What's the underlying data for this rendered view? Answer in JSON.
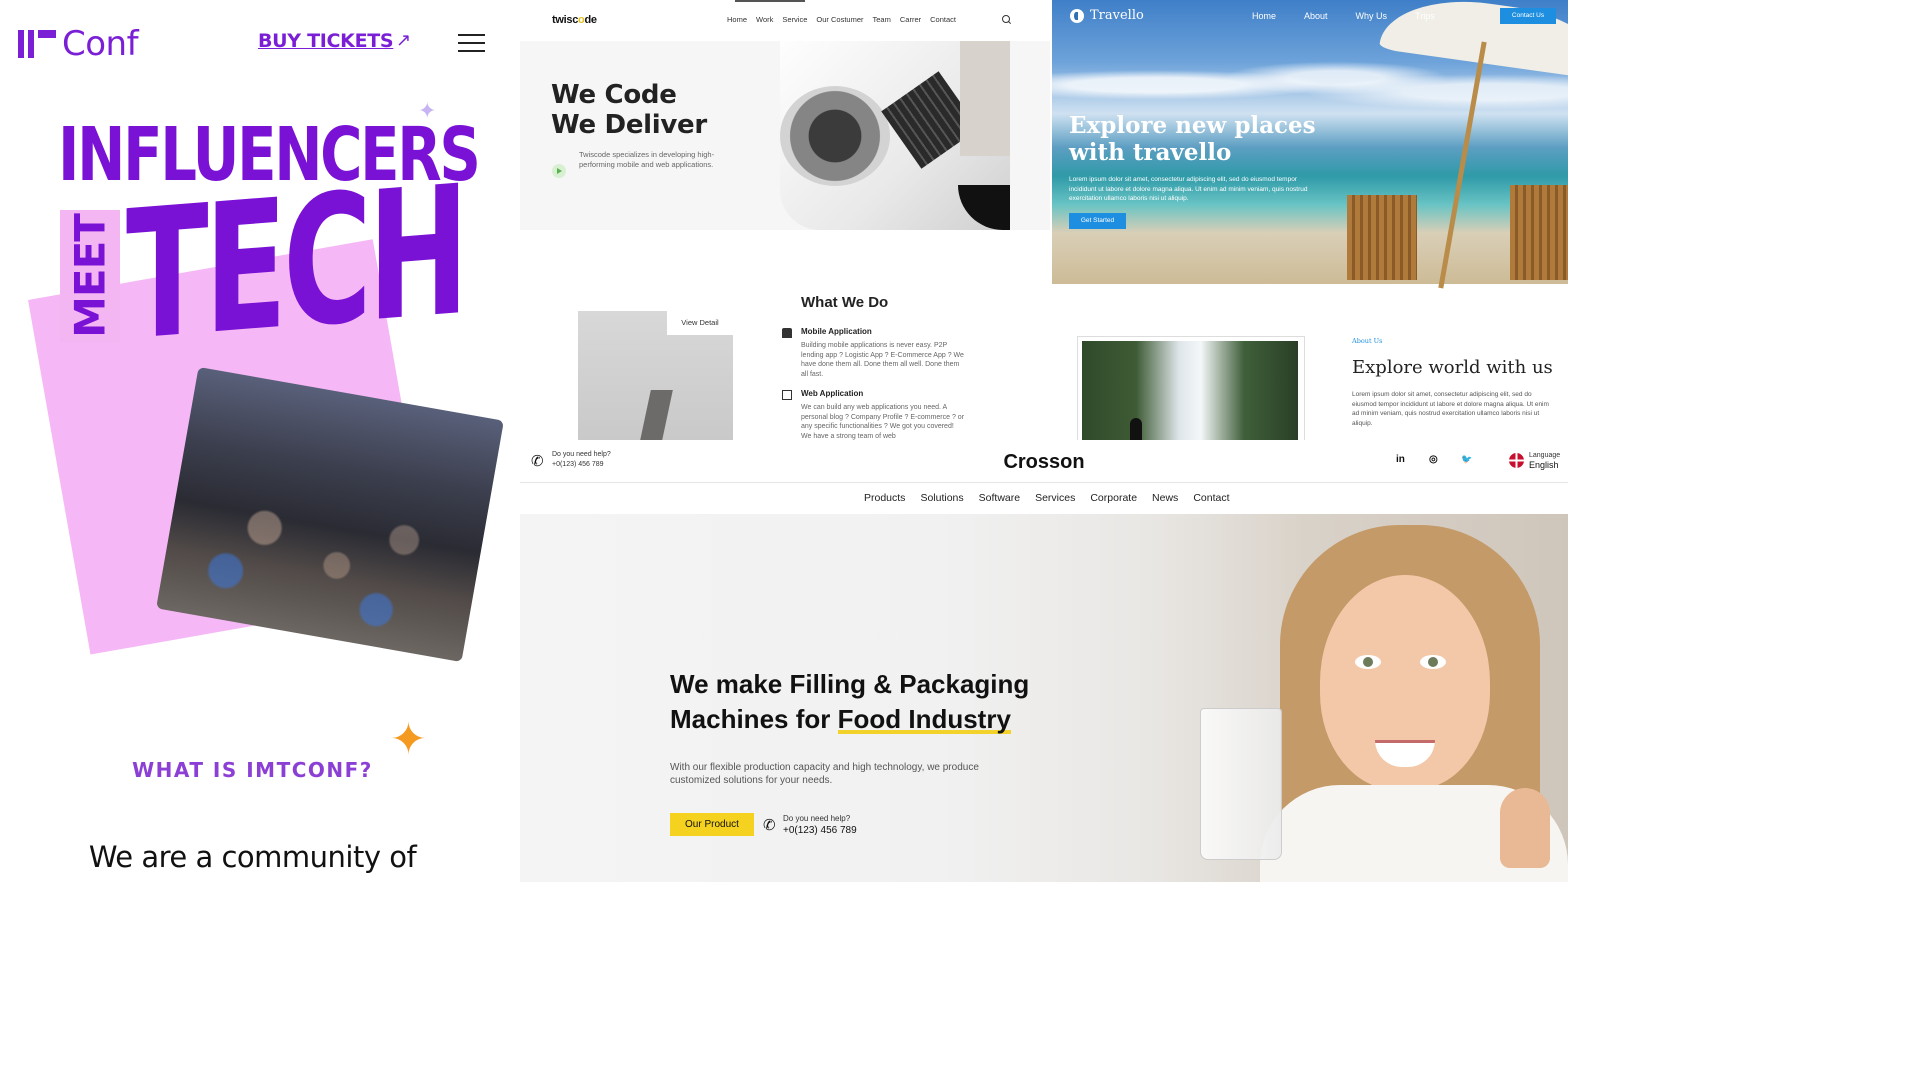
{
  "imtconf": {
    "logo_text": "Conf",
    "buy_tickets": "BUY TICKETS",
    "buy_arrow": "↗",
    "hero_line1": "INFLUENCERS",
    "hero_meet": "MEET",
    "hero_tech": "TECH",
    "what_is": "WHAT IS IMTCONF?",
    "community": "We are a community of",
    "accent_color": "#7a12d6",
    "pink_color": "#f5b7f5",
    "star_color": "#f59a20"
  },
  "twiscode": {
    "brand_main": "twisc",
    "brand_accent": "o",
    "brand_end": "de",
    "nav": [
      "Home",
      "Work",
      "Service",
      "Our Costumer",
      "Team",
      "Carrer",
      "Contact"
    ],
    "hero_line1": "We Code",
    "hero_line2": "We Deliver",
    "hero_sub": "Twiscode specializes in developing high-performing mobile and web applications.",
    "view_detail": "View Detail",
    "what_we_do": "What We Do",
    "services": [
      {
        "title": "Mobile Application",
        "text": "Building mobile applications is never easy. P2P lending app ? Logistic App ? E-Commerce App ? We have done them all. Done them all well. Done them all fast."
      },
      {
        "title": "Web Application",
        "text": "We can build any web applications you need. A personal blog ? Company Profile ? E-commerce ? or any specific functionalities ? We got you covered! We have a strong team of web"
      }
    ]
  },
  "travello": {
    "brand": "Travello",
    "nav": [
      "Home",
      "About",
      "Why Us",
      "Trips"
    ],
    "contact": "Contact Us",
    "hero_title": "Explore new places with travello",
    "hero_text": "Lorem ipsum dolor sit amet, consectetur adipiscing elit, sed do eiusmod tempor incididunt ut labore et dolore magna aliqua. Ut enim ad minim veniam, quis nostrud exercitation ullamco laboris nisi ut aliquip.",
    "get_started": "Get Started",
    "about_label": "About Us",
    "about_title": "Explore world with us",
    "about_text": "Lorem ipsum dolor sit amet, consectetur adipiscing elit, sed do eiusmod tempor incididunt ut labore et dolore magna aliqua. Ut enim ad minim veniam, quis nostrud exercitation ullamco laboris nisi ut aliquip.",
    "accent_color": "#1e8fe0"
  },
  "crosson": {
    "help_question": "Do you need help?",
    "help_number": "+0(123) 456 789",
    "brand": "Crosson",
    "social": [
      "in",
      "◎",
      "🐦"
    ],
    "language_label": "Language",
    "language_value": "English",
    "nav": [
      "Products",
      "Solutions",
      "Software",
      "Services",
      "Corporate",
      "News",
      "Contact"
    ],
    "hero_line1": "We make Filling & Packaging",
    "hero_line2_plain": "Machines for ",
    "hero_line2_underlined": "Food Industry",
    "hero_text": "With our flexible production capacity and high technology, we produce customized solutions for your needs.",
    "cta": "Our Product",
    "help2_question": "Do you need help?",
    "help2_number": "+0(123) 456 789",
    "accent_color": "#f5d21f"
  }
}
